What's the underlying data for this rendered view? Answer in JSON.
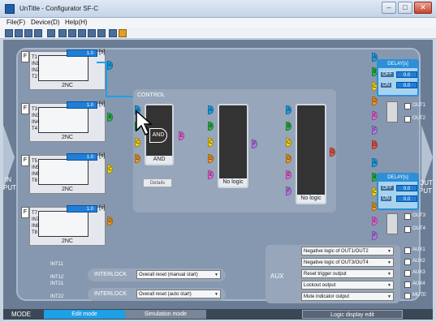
{
  "window": {
    "title": "UnTitle - Configurator SF-C",
    "min": "–",
    "max": "□",
    "close": "✕"
  },
  "menu": [
    "File(F)",
    "Device(D)",
    "Help(H)"
  ],
  "sides": {
    "in_top": "IN",
    "in_bottom": "PUT",
    "out_top": "OUT",
    "out_bottom": "PUT"
  },
  "inputs": [
    {
      "label": "2NC",
      "time": "1.0",
      "unit": "[s]",
      "pins": [
        "T1",
        "IN1",
        "IN2",
        "T2"
      ]
    },
    {
      "label": "2NC",
      "time": "1.0",
      "unit": "[s]",
      "pins": [
        "T3",
        "IN3",
        "IN4",
        "T4"
      ]
    },
    {
      "label": "2NC",
      "time": "1.0",
      "unit": "[s]",
      "pins": [
        "T5",
        "IN5",
        "IN6",
        "T6"
      ]
    },
    {
      "label": "2NC",
      "time": "1.0",
      "unit": "[s]",
      "pins": [
        "T7",
        "IN7",
        "IN8",
        "T8"
      ]
    }
  ],
  "f_tab": "F",
  "control": {
    "title": "CONTROL",
    "and_gate": "AND",
    "blocks": [
      {
        "label": "AND"
      },
      {
        "label": "No logic"
      },
      {
        "label": "No logic"
      }
    ],
    "details": "Details"
  },
  "delays": [
    {
      "title": "DELAY[s]",
      "off_label": "OFF",
      "off_value": "0.0",
      "on_label": "ON",
      "on_value": "0.0"
    },
    {
      "title": "DELAY[s]",
      "off_label": "OFF",
      "off_value": "0.0",
      "on_label": "ON",
      "on_value": "0.0"
    }
  ],
  "outputs": [
    "OUT1",
    "OUT2",
    "OUT3",
    "OUT4"
  ],
  "interlock": [
    {
      "label": "INTERLOCK",
      "value": "Overall reset (manual start)",
      "pins": [
        "INT11",
        "INT12"
      ]
    },
    {
      "label": "INTERLOCK",
      "value": "Overall reset (auto start)",
      "pins": [
        "INT21",
        "INT22"
      ]
    }
  ],
  "aux": {
    "label": "AUX",
    "rows": [
      {
        "value": "Negative logic of OUT1/OUT2",
        "pin": "AUX1"
      },
      {
        "value": "Negative logic of OUT3/OUT4",
        "pin": "AUX2"
      },
      {
        "value": "Reset trigger output",
        "pin": "AUX3"
      },
      {
        "value": "Lockout output",
        "pin": "AUX4"
      },
      {
        "value": "Mute indicator output",
        "pin": "MUTE"
      }
    ]
  },
  "mode": {
    "label": "MODE",
    "edit": "Edit mode",
    "simulation": "Simulation mode",
    "logic_display": "Logic display edit"
  },
  "colors": {
    "edit_mode": "#1ea0e6",
    "accent": "#1f7fd8",
    "bubble_blue": "#1ea0e6",
    "bubble_green": "#2eb84a",
    "bubble_yellow": "#f2d21a",
    "bubble_orange": "#f09a28",
    "bubble_pink": "#e46ad8",
    "bubble_violet": "#b07ce8",
    "bubble_red": "#e4584a"
  },
  "bubbles": {
    "a": "A",
    "b": "B",
    "c": "C",
    "d": "D",
    "e": "E",
    "f": "F",
    "g": "G"
  }
}
